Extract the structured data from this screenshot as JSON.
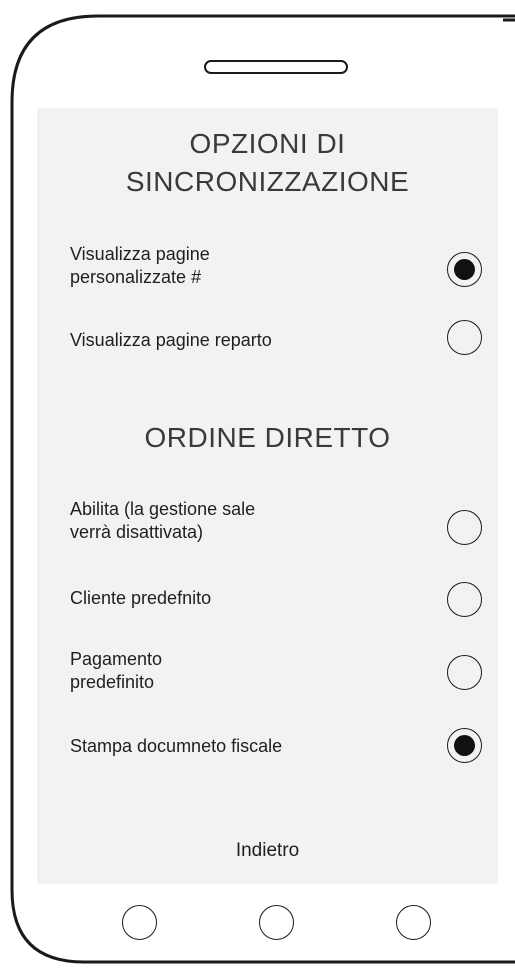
{
  "sync_section": {
    "title_line1": "OPZIONI DI",
    "title_line2": "SINCRONIZZAZIONE",
    "options": [
      {
        "line1": "Visualizza pagine",
        "line2": "personalizzate #",
        "checked": true
      },
      {
        "line1": "Visualizza pagine reparto",
        "line2": "",
        "checked": false
      }
    ]
  },
  "direct_order_section": {
    "title": "ORDINE DIRETTO",
    "options": [
      {
        "line1": "Abilita (la gestione sale",
        "line2": "verrà disattivata)",
        "checked": false
      },
      {
        "line1": "Cliente predefnito",
        "line2": "",
        "checked": false
      },
      {
        "line1": "Pagamento",
        "line2": "predefinito",
        "checked": false
      },
      {
        "line1": "Stampa documneto fiscale",
        "line2": "",
        "checked": true
      }
    ]
  },
  "footer": {
    "back_label": "Indietro"
  },
  "colors": {
    "screen_bg": "#f1f2f3",
    "frame": "#1a1a1a",
    "text": "#1f1f1f"
  }
}
